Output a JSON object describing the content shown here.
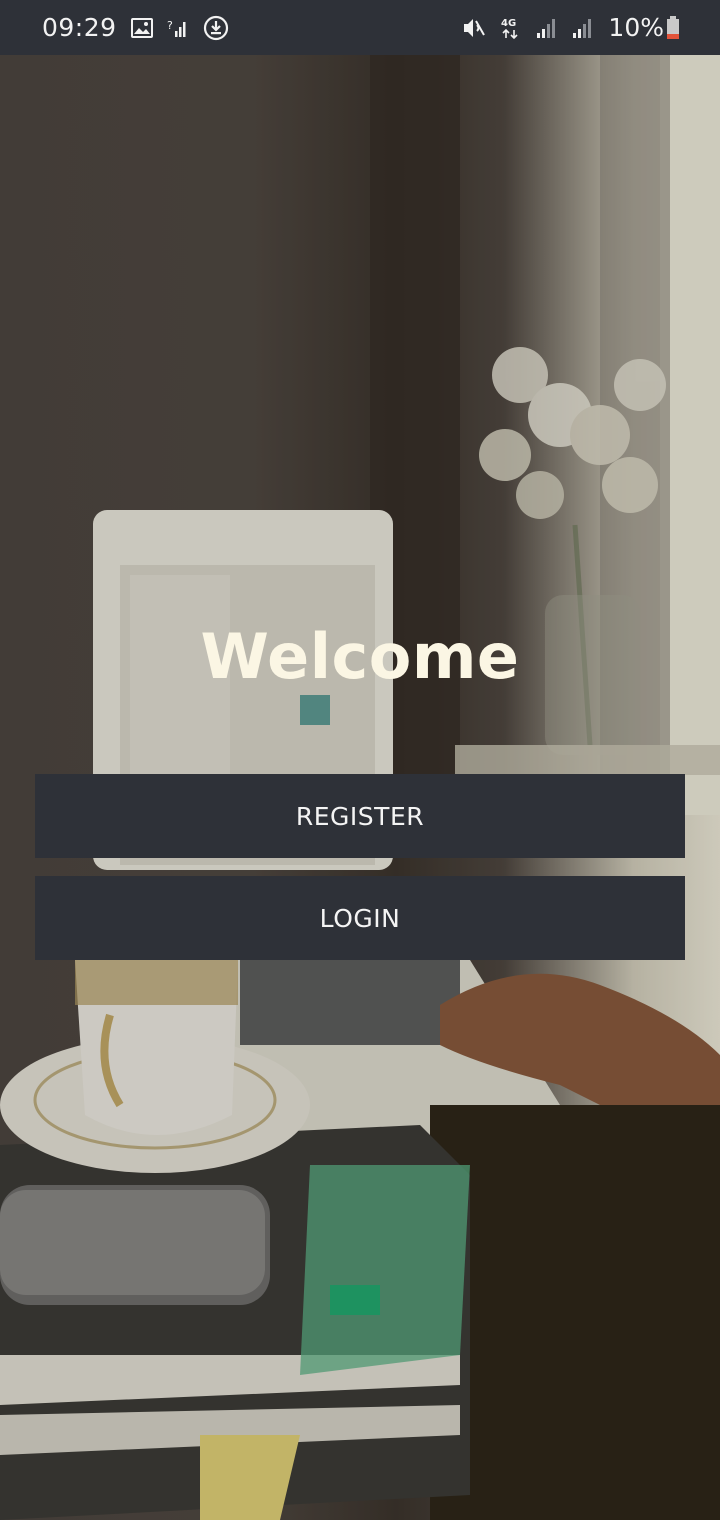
{
  "status_bar": {
    "time": "09:29",
    "battery_percent": "10%",
    "network_label": "4G",
    "icons": [
      "image-icon",
      "no-sim-signal-icon",
      "download-icon",
      "mute-icon",
      "4g-icon",
      "signal-icon",
      "signal-icon",
      "battery-icon"
    ]
  },
  "main": {
    "title": "Welcome",
    "register_label": "REGISTER",
    "login_label": "LOGIN"
  },
  "colors": {
    "status_bar_bg": "#2e3138",
    "button_bg": "#2e3138",
    "title_color": "#fbf6e4",
    "battery_low": "#e2533a"
  }
}
